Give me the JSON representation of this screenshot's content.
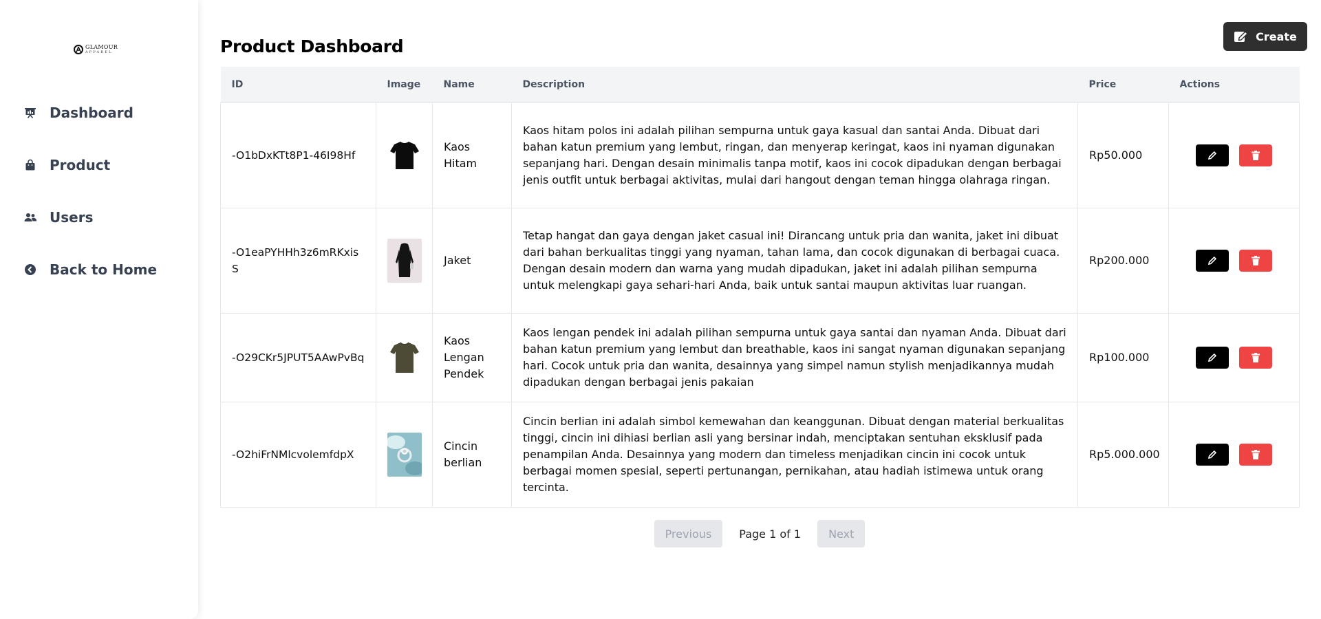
{
  "brand": {
    "logo_line1": "GLAMOUR",
    "logo_line2": "APPAREL",
    "logo_mark": "GA"
  },
  "sidebar": {
    "items": [
      {
        "label": "Dashboard",
        "icon": "presentation-chart-icon"
      },
      {
        "label": "Product",
        "icon": "shopping-bag-icon"
      },
      {
        "label": "Users",
        "icon": "users-icon"
      },
      {
        "label": "Back to Home",
        "icon": "arrow-circle-left-icon"
      }
    ]
  },
  "header": {
    "title": "Product Dashboard",
    "create_label": "Create"
  },
  "table": {
    "columns": [
      "ID",
      "Image",
      "Name",
      "Description",
      "Price",
      "Actions"
    ],
    "rows": [
      {
        "id": "-O1bDxKTt8P1-46I98Hf",
        "name": "Kaos Hitam",
        "description": "Kaos hitam polos ini adalah pilihan sempurna untuk gaya kasual dan santai Anda. Dibuat dari bahan katun premium yang lembut, ringan, dan menyerap keringat, kaos ini nyaman digunakan sepanjang hari. Dengan desain minimalis tanpa motif, kaos ini cocok dipadukan dengan berbagai jenis outfit untuk berbagai aktivitas, mulai dari hangout dengan teman hingga olahraga ringan.",
        "price": "Rp50.000",
        "image": "black-tshirt"
      },
      {
        "id": "-O1eaPYHHh3z6mRKxisS",
        "name": "Jaket",
        "description": "Tetap hangat dan gaya dengan jaket casual ini! Dirancang untuk pria dan wanita, jaket ini dibuat dari bahan berkualitas tinggi yang nyaman, tahan lama, dan cocok digunakan di berbagai cuaca. Dengan desain modern dan warna yang mudah dipadukan, jaket ini adalah pilihan sempurna untuk melengkapi gaya sehari-hari Anda, baik untuk santai maupun aktivitas luar ruangan.",
        "price": "Rp200.000",
        "image": "black-jacket"
      },
      {
        "id": "-O29CKr5JPUT5AAwPvBq",
        "name": "Kaos Lengan Pendek",
        "description": "Kaos lengan pendek ini adalah pilihan sempurna untuk gaya santai dan nyaman Anda. Dibuat dari bahan katun premium yang lembut dan breathable, kaos ini sangat nyaman digunakan sepanjang hari. Cocok untuk pria dan wanita, desainnya yang simpel namun stylish menjadikannya mudah dipadukan dengan berbagai jenis pakaian",
        "price": "Rp100.000",
        "image": "olive-tshirt"
      },
      {
        "id": "-O2hiFrNMlcvolemfdpX",
        "name": "Cincin berlian",
        "description": "Cincin berlian ini adalah simbol kemewahan dan keanggunan. Dibuat dengan material berkualitas tinggi, cincin ini dihiasi berlian asli yang bersinar indah, menciptakan sentuhan eksklusif pada penampilan Anda. Desainnya yang modern dan timeless menjadikan cincin ini cocok untuk berbagai momen spesial, seperti pertunangan, pernikahan, atau hadiah istimewa untuk orang tercinta.",
        "price": "Rp5.000.000",
        "image": "diamond-ring"
      }
    ]
  },
  "pagination": {
    "previous_label": "Previous",
    "page_info": "Page 1 of 1",
    "next_label": "Next"
  },
  "colors": {
    "sidebar_text": "#374151",
    "create_bg": "#2f2f2f",
    "edit_bg": "#000000",
    "delete_bg": "#ef4444",
    "header_bg": "#f3f4f6"
  }
}
